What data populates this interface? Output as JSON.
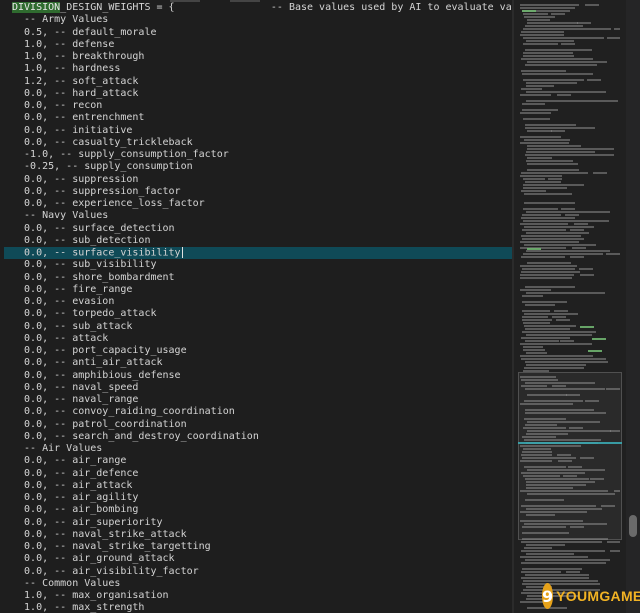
{
  "editor": {
    "header_var": "DIVISION",
    "header_rest": "_DESIGN_WEIGHTS = {                -- Base values used by AI to evaluate value of",
    "lines": [
      "  -- Army Values",
      "  0.5, -- default_morale",
      "  1.0, -- defense",
      "  1.0, -- breakthrough",
      "  1.0, -- hardness",
      "  1.2, -- soft_attack",
      "  0.0, -- hard_attack",
      "  0.0, -- recon",
      "  0.0, -- entrenchment",
      "  0.0, -- initiative",
      "  0.0, -- casualty_trickleback",
      "  -1.0, -- supply_consumption_factor",
      "  -0.25, -- supply_consumption",
      "  0.0, -- suppression",
      "  0.0, -- suppression_factor",
      "  0.0, -- experience_loss_factor",
      "  -- Navy Values",
      "  0.0, -- surface_detection",
      "  0.0, -- sub_detection",
      "  0.0, -- surface_visibility",
      "  0.0, -- sub_visibility",
      "  0.0, -- shore_bombardment",
      "  0.0, -- fire_range",
      "  0.0, -- evasion",
      "  0.0, -- torpedo_attack",
      "  0.0, -- sub_attack",
      "  0.0, -- attack",
      "  0.0, -- port_capacity_usage",
      "  0.0, -- anti_air_attack",
      "  0.0, -- amphibious_defense",
      "  0.0, -- naval_speed",
      "  0.0, -- naval_range",
      "  0.0, -- convoy_raiding_coordination",
      "  0.0, -- patrol_coordination",
      "  0.0, -- search_and_destroy_coordination",
      "  -- Air Values",
      "  0.0, -- air_range",
      "  0.0, -- air_defence",
      "  0.0, -- air_attack",
      "  0.0, -- air_agility",
      "  0.0, -- air_bombing",
      "  0.0, -- air_superiority",
      "  0.0, -- naval_strike_attack",
      "  0.0, -- naval_strike_targetting",
      "  0.0, -- air_ground_attack",
      "  0.0, -- air_visibility_factor",
      "  -- Common Values",
      "  1.0, -- max_organisation",
      "  1.0, -- max_strength"
    ],
    "highlighted_line_index": 19
  },
  "watermark": {
    "logo_text": "9",
    "text": "YOUMGAME"
  }
}
